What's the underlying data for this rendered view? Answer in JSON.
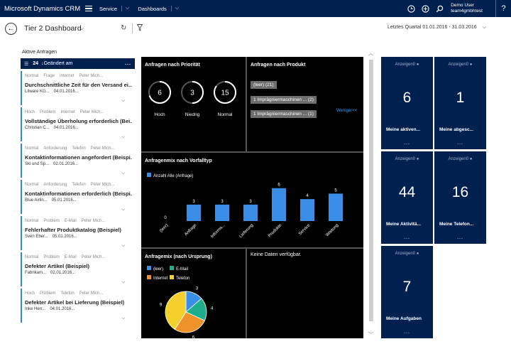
{
  "app": {
    "brand": "Microsoft Dynamics CRM",
    "nav": [
      "Service",
      "Dashboards"
    ],
    "user_name": "Demo User",
    "user_org": "team4gmbhtest",
    "help": "?"
  },
  "header": {
    "title": "Tier 2 Dashboard",
    "period": "Letztes Quartal 01.01.2016 - 31.03.2016"
  },
  "left": {
    "title": "Aktive Anfragen",
    "count": "24",
    "sort": "Geändert am",
    "more": "...",
    "items": [
      {
        "tags": [
          "Normal",
          "Frage",
          "Internet",
          "Peter Mich..."
        ],
        "title": "Durchschnittliche Zeit für den Versand ei...",
        "sub1": "Litware KG...",
        "sub2": "04.01.2016..."
      },
      {
        "tags": [
          "Hoch",
          "Problem",
          "Internet",
          "Peter Mich..."
        ],
        "title": "Vollständige Überholung erforderlich (Bei...",
        "sub1": "Christian C...",
        "sub2": "04.01.2016..."
      },
      {
        "tags": [
          "Normal",
          "Anforderung",
          "Telefon",
          "Peter Mich..."
        ],
        "title": "Kontaktinformationen angefordert (Beispi...",
        "sub1": "Ski und Sp...",
        "sub2": "02.01.2016..."
      },
      {
        "tags": [
          "Normal",
          "Anforderung",
          "Telefon",
          "Peter Mich..."
        ],
        "title": "Kontaktinformationen erforderlich (Beispi...",
        "sub1": "Blue Airlin...",
        "sub2": "05.01.2016..."
      },
      {
        "tags": [
          "Normal",
          "Problem",
          "E-Mail",
          "Peter Mich..."
        ],
        "title": "Fehlerhafter Produktkatalog (Beispiel)",
        "sub1": "Sven Eber...",
        "sub2": "05.01.2016..."
      },
      {
        "tags": [
          "Normal",
          "Problem",
          "E-Mail",
          "Peter Mich..."
        ],
        "title": "Defekter Artikel (Beispiel)",
        "sub1": "Fabrikam...",
        "sub2": "02.01.2016..."
      },
      {
        "tags": [
          "Hoch",
          "Problem",
          "Telefon",
          "Peter Mich..."
        ],
        "title": "Defekter Artikel bei Lieferung (Beispiel)",
        "sub1": "Inke Herr...",
        "sub2": "04.01.2016..."
      }
    ]
  },
  "priority": {
    "title": "Anfragen nach Priorität",
    "rings": [
      {
        "value": "6",
        "label": "Hoch",
        "fraction": 0.7
      },
      {
        "value": "3",
        "label": "Niedrig",
        "fraction": 0.5
      },
      {
        "value": "15",
        "label": "Normal",
        "fraction": 0.85
      }
    ]
  },
  "product": {
    "title": "Anfragen nach Produkt",
    "tags": [
      "(leer) (21)",
      "1 Imprägniermaschinen ... (2)",
      "1 Imprägniermaschinen ... (1)"
    ],
    "less": "Weniger<<"
  },
  "mix": {
    "title": "Anfragenmix nach Vorfalltyp",
    "legend": "Anzahl Alle (Anfrage)",
    "color": "#3a8ee6"
  },
  "origin": {
    "title": "Anfragemix (nach Ursprung)",
    "legend": [
      {
        "label": "(leer)",
        "color": "#3a8ee6"
      },
      {
        "label": "E-Mail",
        "color": "#1fae8c"
      },
      {
        "label": "Internet",
        "color": "#f0922a"
      },
      {
        "label": "Telefon",
        "color": "#f3d02c"
      }
    ]
  },
  "nodata": {
    "text": "Keine Daten verfügbar."
  },
  "tiles": [
    {
      "header": "Anzeigen0",
      "number": "6",
      "label": "Meine aktiven...",
      "more": "..."
    },
    {
      "header": "Anzeigen0",
      "number": "1",
      "label": "Meine abgesc...",
      "more": "..."
    },
    {
      "header": "Anzeigen0",
      "number": "44",
      "label": "Meine Aktivitä...",
      "more": "..."
    },
    {
      "header": "Anzeigen0",
      "number": "16",
      "label": "Meine Telefon...",
      "more": "..."
    },
    {
      "header": "Anzeigen0",
      "number": "7",
      "label": "Meine Aufgaben",
      "more": "..."
    }
  ],
  "chart_data": [
    {
      "type": "bar",
      "title": "Anfragenmix nach Vorfalltyp",
      "categories": [
        "(leer)",
        "Anfrage",
        "Informa...",
        "Lieferung",
        "Produkte",
        "Service",
        "Wartung"
      ],
      "series": [
        {
          "name": "Anzahl Alle (Anfrage)",
          "values": [
            0,
            3,
            3,
            3,
            6,
            4,
            5
          ]
        }
      ],
      "ylim": [
        0,
        7
      ],
      "grid": false,
      "legend": "top-left"
    },
    {
      "type": "pie",
      "title": "Anfragemix (nach Ursprung)",
      "labels": [
        "(leer)",
        "E-Mail",
        "Internet",
        "Telefon"
      ],
      "values": [
        3,
        4,
        6,
        9
      ],
      "legend": "top-left"
    }
  ]
}
